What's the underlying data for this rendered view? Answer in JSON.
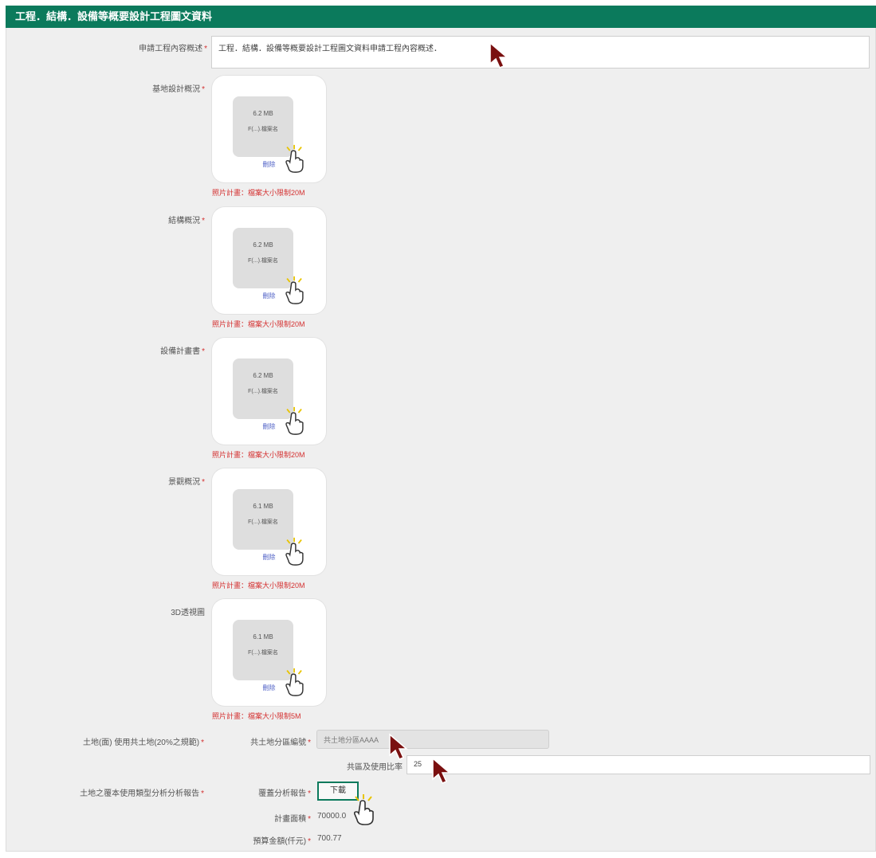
{
  "header": {
    "title": "工程．結構．設備等概要設計工程圖文資料"
  },
  "desc": {
    "label": "申請工程內容概述",
    "value": "工程．結構．設備等概要設計工程圖文資料申請工程內容概述．"
  },
  "uploads": [
    {
      "label": "基地設計概況",
      "size": "6.2 MB",
      "file": "F(...).檔案名",
      "delete": "刪除",
      "note": "照片計畫：檔案大小限制20M",
      "required": true
    },
    {
      "label": "結構概況",
      "size": "6.2 MB",
      "file": "F(...).檔案名",
      "delete": "刪除",
      "note": "照片計畫：檔案大小限制20M",
      "required": true
    },
    {
      "label": "設備計畫書",
      "size": "6.2 MB",
      "file": "F(...).檔案名",
      "delete": "刪除",
      "note": "照片計畫：檔案大小限制20M",
      "required": true
    },
    {
      "label": "景觀概況",
      "size": "6.1 MB",
      "file": "F(...).檔案名",
      "delete": "刪除",
      "note": "照片計畫：檔案大小限制20M",
      "required": true
    },
    {
      "label": "3D透視圖",
      "size": "6.1 MB",
      "file": "F(...).檔案名",
      "delete": "刪除",
      "note": "照片計畫：檔案大小限制5M",
      "required": false
    }
  ],
  "land": {
    "section_label": "土地(面) 使用共土地(20%之規範)",
    "code_label": "共土地分區編號",
    "code_value": "共土地分區AAAA",
    "ratio_label": "共區及使用比率",
    "ratio_value": "25"
  },
  "analysis": {
    "section_label": "土地之覆本使用類型分析分析報告",
    "report_label": "覆蓋分析報告",
    "download_label": "下載",
    "area_label": "計畫面積",
    "area_value": "70000.0",
    "amount_label": "預算金額(仟元)",
    "amount_value": "700.77"
  },
  "colors": {
    "header": "#0b7a5c",
    "required": "#d43030",
    "link": "#4a5cc4",
    "panel": "#efefef"
  }
}
